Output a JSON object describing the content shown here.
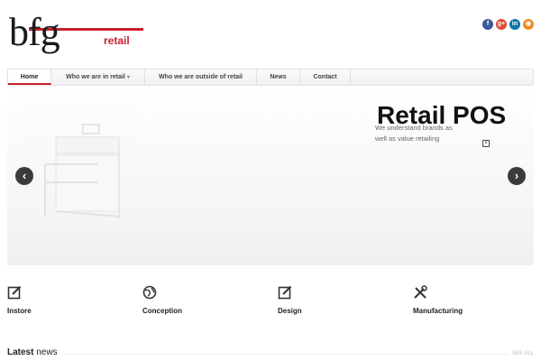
{
  "logo": {
    "main": "bfg",
    "sub": "retail",
    "brand_color": "#c8202c"
  },
  "social": [
    {
      "name": "facebook",
      "glyph": "f",
      "color": "#3b5998"
    },
    {
      "name": "google-plus",
      "glyph": "g+",
      "color": "#dd4b39"
    },
    {
      "name": "linkedin",
      "glyph": "in",
      "color": "#0e76a8"
    },
    {
      "name": "rss",
      "glyph": "◉",
      "color": "#f08a24"
    }
  ],
  "nav": {
    "items": [
      {
        "label": "Home",
        "active": true
      },
      {
        "label": "Who we are in retail",
        "dropdown": true
      },
      {
        "label": "Who we are outside of retail"
      },
      {
        "label": "News"
      },
      {
        "label": "Contact"
      }
    ]
  },
  "slider": {
    "title": "Retail POS",
    "subtitle": "We understand brands as well as value retailing",
    "prev": "‹",
    "next": "›"
  },
  "features": [
    {
      "label": "Instore",
      "icon": "edit-icon"
    },
    {
      "label": "Conception",
      "icon": "globe-icon"
    },
    {
      "label": "Design",
      "icon": "edit-icon"
    },
    {
      "label": "Manufacturing",
      "icon": "tools-icon"
    }
  ],
  "news": {
    "heading_bold": "Latest",
    "heading_rest": " news",
    "see_all": "SEE ALL"
  }
}
